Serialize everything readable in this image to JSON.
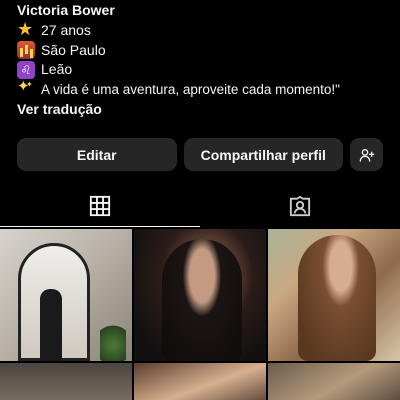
{
  "profile": {
    "name": "Victoria Bower",
    "bio": [
      {
        "icon": "star-emoji-icon",
        "text": "27 anos"
      },
      {
        "icon": "city-emoji-icon",
        "text": "São Paulo"
      },
      {
        "icon": "leo-emoji-icon",
        "text": "Leão"
      },
      {
        "icon": "sparkles-emoji-icon",
        "text": "A vida é uma aventura, aproveite cada momento!\""
      }
    ],
    "translate_label": "Ver tradução"
  },
  "actions": {
    "edit_label": "Editar",
    "share_label": "Compartilhar perfil",
    "add_icon": "add-person-icon"
  },
  "tabs": [
    {
      "name": "grid",
      "icon": "grid-icon",
      "active": true
    },
    {
      "name": "tagged",
      "icon": "tagged-person-icon",
      "active": false
    }
  ],
  "colors": {
    "background": "#000000",
    "button": "#262626",
    "text": "#f5f5f5"
  }
}
